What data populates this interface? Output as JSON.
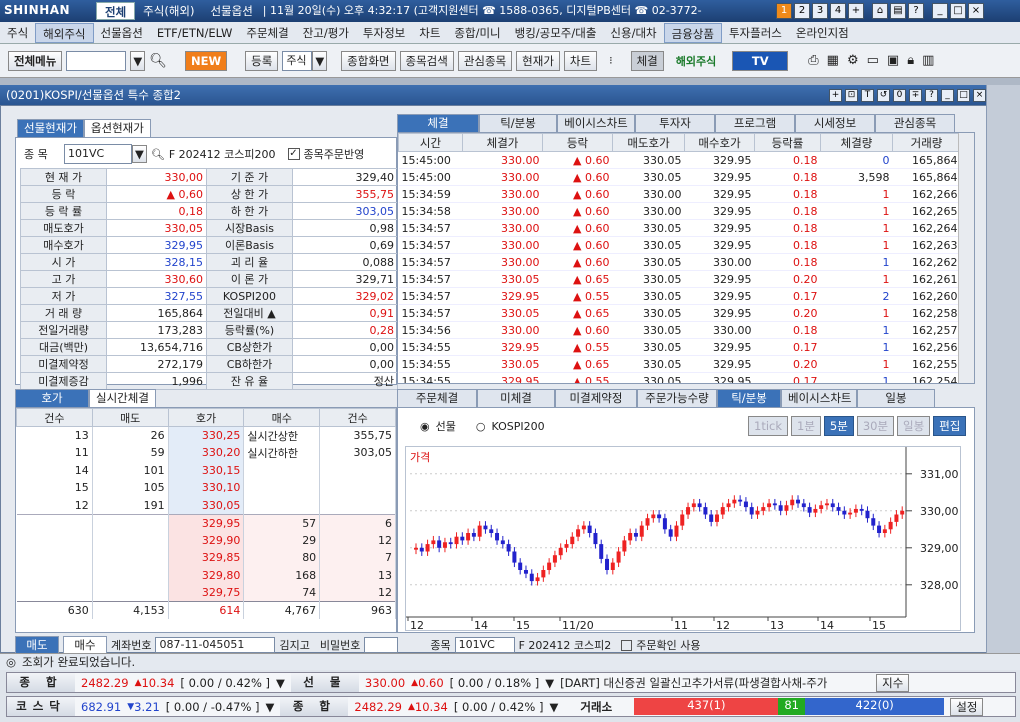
{
  "titlebar": {
    "logo": "SHINHAN",
    "tabs": [
      "전체",
      "주식(해외)",
      "선물옵션"
    ],
    "status_text": "| 11월 20일(수) 오후 4:32:17 (고객지원센터 ☎ 1588-0365, 디지털PB센터 ☎ 02-3772-",
    "nums": [
      "1",
      "2",
      "3",
      "4",
      "+"
    ],
    "icons": [
      "home-icon",
      "print-icon",
      "help-icon"
    ]
  },
  "menu": [
    "주식",
    "해외주식",
    "선물옵션",
    "ETF/ETN/ELW",
    "주문체결",
    "잔고/평가",
    "투자정보",
    "차트",
    "종합/미니",
    "뱅킹/공모주/대출",
    "신용/대차",
    "금융상품",
    "투자플러스",
    "온라인지점"
  ],
  "toolbar": {
    "all_menu": "전체메뉴",
    "new": "NEW",
    "register": "등록",
    "stock": "주식",
    "btns": [
      "종합화면",
      "종목검색",
      "관심종목",
      "현재가",
      "차트"
    ],
    "trade": "체결",
    "overseas": "해외주식",
    "tv": "TV"
  },
  "window": {
    "title": "(0201)KOSPI/선물옵션 특수 종합2",
    "ctrls": [
      "+",
      "⊡",
      "T",
      "↺",
      "0",
      "∓",
      "?",
      "_",
      "□",
      "×"
    ]
  },
  "left": {
    "tabs": [
      "선물현재가",
      "옵션현재가"
    ],
    "code_label": "종  목",
    "code": "101VC",
    "name": "F 202412 코스피200",
    "chk": "종목주문반영",
    "rows": [
      [
        "현 재 가",
        "330,00",
        "기 준 가",
        "329,40"
      ],
      [
        "등    락",
        "0,60",
        "상 한 가",
        "355,75"
      ],
      [
        "등 락 률",
        "0,18",
        "하 한 가",
        "303,05"
      ],
      [
        "매도호가",
        "330,05",
        "시장Basis",
        "0,98"
      ],
      [
        "매수호가",
        "329,95",
        "이론Basis",
        "0,69"
      ],
      [
        "시    가",
        "328,15",
        "괴 리 율",
        "0,088"
      ],
      [
        "고    가",
        "330,60",
        "이 론 가",
        "329,71"
      ],
      [
        "저    가",
        "327,55",
        "KOSPI200",
        "329,02"
      ],
      [
        "거 래 량",
        "165,864",
        "전일대비",
        "0,91"
      ],
      [
        "전일거래량",
        "173,283",
        "등락률(%)",
        "0,28"
      ],
      [
        "대금(백만)",
        "13,654,716",
        "CB상한가",
        "0,00"
      ],
      [
        "미결제약정",
        "272,179",
        "CB하한가",
        "0,00"
      ],
      [
        "미결제증감",
        "1,996",
        "잔 유 율",
        "정산"
      ]
    ],
    "ob_tabs": [
      "호가",
      "실시간체결"
    ],
    "ob_head": [
      "건수",
      "매도",
      "호가",
      "매수",
      "건수"
    ],
    "asks": [
      [
        "13",
        "26",
        "330,25"
      ],
      [
        "11",
        "59",
        "330,20"
      ],
      [
        "14",
        "101",
        "330,15"
      ],
      [
        "15",
        "105",
        "330,10"
      ],
      [
        "12",
        "191",
        "330,05"
      ]
    ],
    "bids": [
      [
        "329,95",
        "57",
        "6"
      ],
      [
        "329,90",
        "29",
        "12"
      ],
      [
        "329,85",
        "80",
        "7"
      ],
      [
        "329,80",
        "168",
        "13"
      ],
      [
        "329,75",
        "74",
        "12"
      ]
    ],
    "ob_side": [
      [
        "실시간상한",
        "355,75"
      ],
      [
        "실시간하한",
        "303,05"
      ]
    ],
    "ob_total": [
      "630",
      "4,153",
      "614",
      "4,767",
      "963"
    ],
    "bottom": {
      "sell": "매도",
      "buy": "매수",
      "acct_label": "계좌번호",
      "acct": "087-11-045051",
      "pw1": "김지고",
      "pw2": "비밀번호",
      "code_label": "종목",
      "code": "101VC",
      "name": "F 202412 코스피2",
      "chk": "주문확인 사용"
    }
  },
  "right": {
    "tabs": [
      "체결",
      "틱/분봉",
      "베이시스차트",
      "투자자",
      "프로그램",
      "시세정보",
      "관심종목"
    ],
    "head": [
      "시간",
      "체결가",
      "등락",
      "매도호가",
      "매수호가",
      "등락률",
      "체결량",
      "거래량"
    ],
    "rows": [
      [
        "15:45:00",
        "330.00",
        "0.60",
        "330.05",
        "329.95",
        "0.18",
        "0",
        "165,864",
        "b"
      ],
      [
        "15:45:00",
        "330.00",
        "0.60",
        "330.05",
        "329.95",
        "0.18",
        "3,598",
        "165,864",
        "k"
      ],
      [
        "15:34:59",
        "330.00",
        "0.60",
        "330.00",
        "329.95",
        "0.18",
        "1",
        "162,266",
        "r"
      ],
      [
        "15:34:58",
        "330.00",
        "0.60",
        "330.00",
        "329.95",
        "0.18",
        "1",
        "162,265",
        "r"
      ],
      [
        "15:34:57",
        "330.00",
        "0.60",
        "330.05",
        "329.95",
        "0.18",
        "1",
        "162,264",
        "r"
      ],
      [
        "15:34:57",
        "330.00",
        "0.60",
        "330.05",
        "329.95",
        "0.18",
        "1",
        "162,263",
        "r"
      ],
      [
        "15:34:57",
        "330.00",
        "0.60",
        "330.05",
        "330.00",
        "0.18",
        "1",
        "162,262",
        "b"
      ],
      [
        "15:34:57",
        "330.05",
        "0.65",
        "330.05",
        "329.95",
        "0.20",
        "1",
        "162,261",
        "r"
      ],
      [
        "15:34:57",
        "329.95",
        "0.55",
        "330.05",
        "329.95",
        "0.17",
        "2",
        "162,260",
        "b"
      ],
      [
        "15:34:57",
        "330.05",
        "0.65",
        "330.05",
        "329.95",
        "0.20",
        "1",
        "162,258",
        "r"
      ],
      [
        "15:34:56",
        "330.00",
        "0.60",
        "330.05",
        "330.00",
        "0.18",
        "1",
        "162,257",
        "b"
      ],
      [
        "15:34:55",
        "329.95",
        "0.55",
        "330.05",
        "329.95",
        "0.17",
        "1",
        "162,256",
        "b"
      ],
      [
        "15:34:55",
        "330.05",
        "0.65",
        "330.05",
        "329.95",
        "0.20",
        "1",
        "162,255",
        "r"
      ],
      [
        "15:34:55",
        "329.95",
        "0.55",
        "330.05",
        "329.95",
        "0.17",
        "1",
        "162,254",
        "b"
      ]
    ],
    "tabs2": [
      "주문체결",
      "미체결",
      "미결제약정",
      "주문가능수량",
      "틱/분봉",
      "베이시스차트",
      "일봉"
    ],
    "radio": [
      "선물",
      "KOSPI200"
    ],
    "periods": [
      "1tick",
      "1분",
      "5분",
      "30분",
      "일봉",
      "편집"
    ],
    "chart_label": "가격"
  },
  "chart_data": {
    "type": "candlestick",
    "yticks": [
      "331,00",
      "330,00",
      "329,00",
      "328,00"
    ],
    "ylim": [
      327.4,
      331.4
    ],
    "xticks": [
      "12",
      "14",
      "15",
      "11/20",
      "11",
      "12",
      "13",
      "14",
      "15"
    ],
    "closes": [
      329.0,
      328.9,
      329.1,
      329.2,
      329.0,
      329.15,
      329.1,
      329.3,
      329.2,
      329.4,
      329.3,
      329.6,
      329.5,
      329.4,
      329.2,
      329.1,
      328.9,
      328.6,
      328.4,
      328.3,
      328.1,
      328.2,
      328.4,
      328.6,
      328.8,
      329.0,
      329.1,
      329.3,
      329.5,
      329.6,
      329.4,
      329.1,
      328.7,
      328.4,
      328.6,
      328.9,
      329.2,
      329.4,
      329.3,
      329.6,
      329.8,
      329.9,
      329.8,
      329.5,
      329.3,
      329.6,
      329.9,
      330.1,
      330.2,
      330.1,
      329.9,
      329.7,
      329.9,
      330.1,
      330.2,
      330.3,
      330.25,
      330.1,
      329.9,
      330.0,
      330.1,
      330.2,
      330.15,
      330.0,
      330.15,
      330.3,
      330.2,
      330.1,
      329.95,
      330.05,
      330.15,
      330.2,
      330.1,
      330.0,
      329.9,
      329.95,
      330.05,
      330.0,
      329.8,
      329.6,
      329.4,
      329.5,
      329.7,
      329.9,
      330.0
    ]
  },
  "status": {
    "msg": "조회가 완료되었습니다."
  },
  "tickers": [
    {
      "name": "종  합",
      "v": "2482.29",
      "d": "10.34",
      "ext": "[ 0.00  / 0.42% ]",
      "name2": "선  물",
      "v2": "330.00",
      "d2": "0.60",
      "ext2": "[ 0.00  / 0.18% ]",
      "news": "[DART] 대신증권 일괄신고추가서류(파생결합사채-주가",
      "btn": "지수"
    },
    {
      "name": "코스닥",
      "v": "682.91",
      "d": "3.21",
      "ext": "[ 0.00  / -0.47% ]",
      "name2": "종  합",
      "v2": "2482.29",
      "d2": "10.34",
      "ext2": "[ 0.00  / 0.42% ]",
      "ex": "거래소",
      "up": "437(1)",
      "eq": "81",
      "dn": "422(0)",
      "btn": "설정"
    }
  ]
}
